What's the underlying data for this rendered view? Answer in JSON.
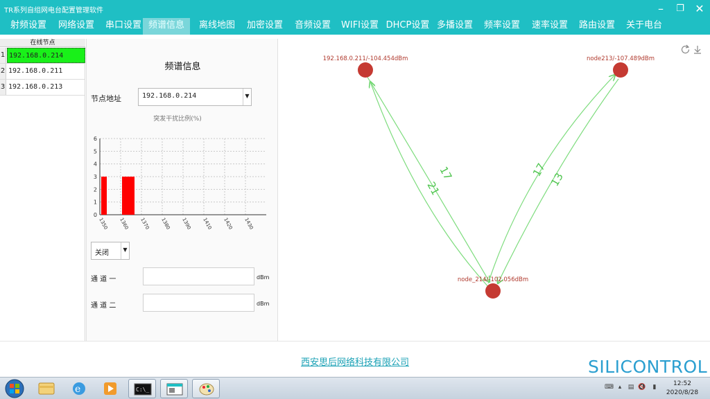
{
  "window": {
    "title": "TR系列自组网电台配置管理软件"
  },
  "menu": {
    "tabs": [
      {
        "label": "射频设置",
        "active": false
      },
      {
        "label": "网络设置",
        "active": false
      },
      {
        "label": "串口设置",
        "active": false
      },
      {
        "label": "频谱信息",
        "active": true
      },
      {
        "label": "离线地图",
        "active": false
      },
      {
        "label": "加密设置",
        "active": false
      },
      {
        "label": "音频设置",
        "active": false
      },
      {
        "label": "WIFI设置",
        "active": false
      },
      {
        "label": "DHCP设置",
        "active": false
      },
      {
        "label": "多播设置",
        "active": false
      },
      {
        "label": "频率设置",
        "active": false
      },
      {
        "label": "速率设置",
        "active": false
      },
      {
        "label": "路由设置",
        "active": false
      },
      {
        "label": "关于电台",
        "active": false
      }
    ]
  },
  "nodes": {
    "header": "在线节点",
    "rows": [
      {
        "index": "1",
        "ip": "192.168.0.214",
        "selected": true
      },
      {
        "index": "2",
        "ip": "192.168.0.211",
        "selected": false
      },
      {
        "index": "3",
        "ip": "192.168.0.213",
        "selected": false
      }
    ]
  },
  "spectrum": {
    "title": "频谱信息",
    "address_label": "节点地址",
    "address_value": "192.168.0.214",
    "chart_title": "突发干扰比例(%)",
    "switch_value": "关闭",
    "channel1_label": "通 道 一",
    "channel2_label": "通 道 二",
    "channel1_value": "",
    "channel2_value": "",
    "unit": "dBm"
  },
  "chart_data": {
    "type": "bar",
    "title": "突发干扰比例(%)",
    "x": [
      1350,
      1360
    ],
    "values": [
      3,
      3
    ],
    "x_ticks": [
      "1350",
      "1360",
      "1370",
      "1380",
      "1390",
      "1410",
      "1420",
      "1430"
    ],
    "y_ticks": [
      "0",
      "1",
      "2",
      "3",
      "4",
      "5",
      "6"
    ],
    "ylim": [
      0,
      6
    ],
    "grid": true,
    "bar_color": "#ff0000"
  },
  "topology": {
    "nodes": [
      {
        "id": "n211",
        "label": "192.168.0.211/-104.454dBm"
      },
      {
        "id": "n213",
        "label": "node213/-107.489dBm"
      },
      {
        "id": "n214",
        "label": "node_214/-102.056dBm"
      }
    ],
    "links": [
      {
        "label": "21"
      },
      {
        "label": "17"
      },
      {
        "label": "17"
      },
      {
        "label": "13"
      }
    ],
    "node_color": "#c0392b",
    "link_color": "#6cd46c",
    "label_color": "#b03a2e"
  },
  "footer": {
    "company": "西安思后网络科技有限公司",
    "brand": "SILICONTROL"
  },
  "taskbar": {
    "time": "12:52",
    "date": "2020/8/28"
  }
}
